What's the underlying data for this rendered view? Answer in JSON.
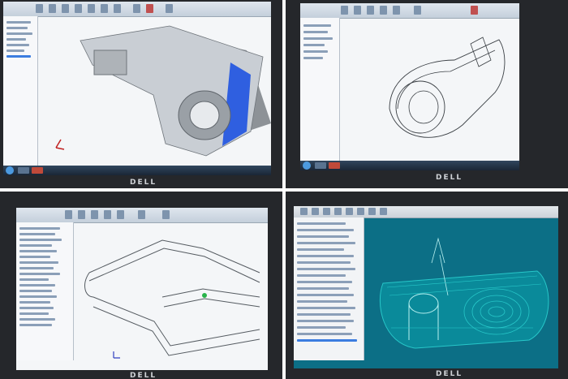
{
  "photos": [
    {
      "id": "top-left",
      "brand": "DELL"
    },
    {
      "id": "top-right",
      "brand": "DELL"
    },
    {
      "id": "bottom-left",
      "brand": "DELL"
    },
    {
      "id": "bottom-right",
      "brand": "DELL"
    }
  ],
  "colors": {
    "part_gray": "#c9ced4",
    "face_blue": "#2f5fe0",
    "wire_cyan": "#27c7c9",
    "cam_bg": "#0c6f86"
  }
}
